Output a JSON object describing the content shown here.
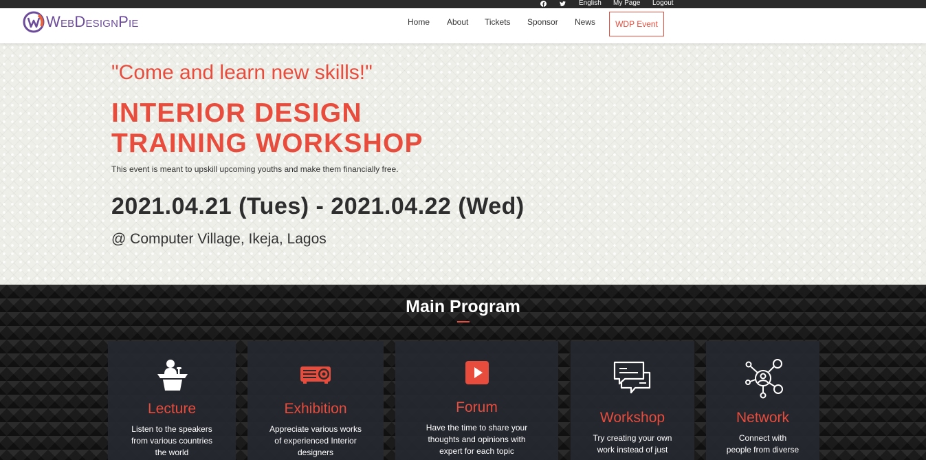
{
  "topbar": {
    "facebook_icon": "facebook-icon",
    "twitter_icon": "twitter-icon",
    "language": "English",
    "my_page": "My Page",
    "logout": "Logout"
  },
  "brand": {
    "name": "WebDesignPie",
    "logo_icon": "wdp-logo-icon",
    "colors": {
      "purple": "#6b4b9a",
      "orange": "#e8623a",
      "accent": "#e74c3c"
    }
  },
  "nav": {
    "items": [
      "Home",
      "About",
      "Tickets",
      "Sponsor",
      "News"
    ],
    "cta": "WDP Event"
  },
  "hero": {
    "tagline": "\"Come and learn new skills!\"",
    "title_lines": [
      "INTERIOR DESIGN",
      "TRAINING WORKSHOP"
    ],
    "description": "This event is meant to upskill upcoming youths and make them financially free.",
    "date": "2021.04.21 (Tues) - 2021.04.22 (Wed)",
    "venue": "@ Computer Village, Ikeja, Lagos"
  },
  "program": {
    "title": "Main Program",
    "cards": [
      {
        "icon": "lecture-podium-icon",
        "title": "Lecture",
        "lines": [
          "Listen to the speakers",
          "from various countries",
          "the world"
        ]
      },
      {
        "icon": "projector-icon",
        "title": "Exhibition",
        "lines": [
          "Appreciate various works",
          "of experienced Interior",
          "designers"
        ]
      },
      {
        "icon": "play-icon",
        "title": "Forum",
        "lines": [
          "Have the time to share your",
          "thoughts and opinions with",
          "expert for each topic"
        ]
      },
      {
        "icon": "chat-bubbles-icon",
        "title": "Workshop",
        "lines": [
          "Try creating your own",
          "work instead of just"
        ]
      },
      {
        "icon": "network-people-icon",
        "title": "Network",
        "lines": [
          "Connect with",
          "people from diverse"
        ]
      }
    ]
  }
}
